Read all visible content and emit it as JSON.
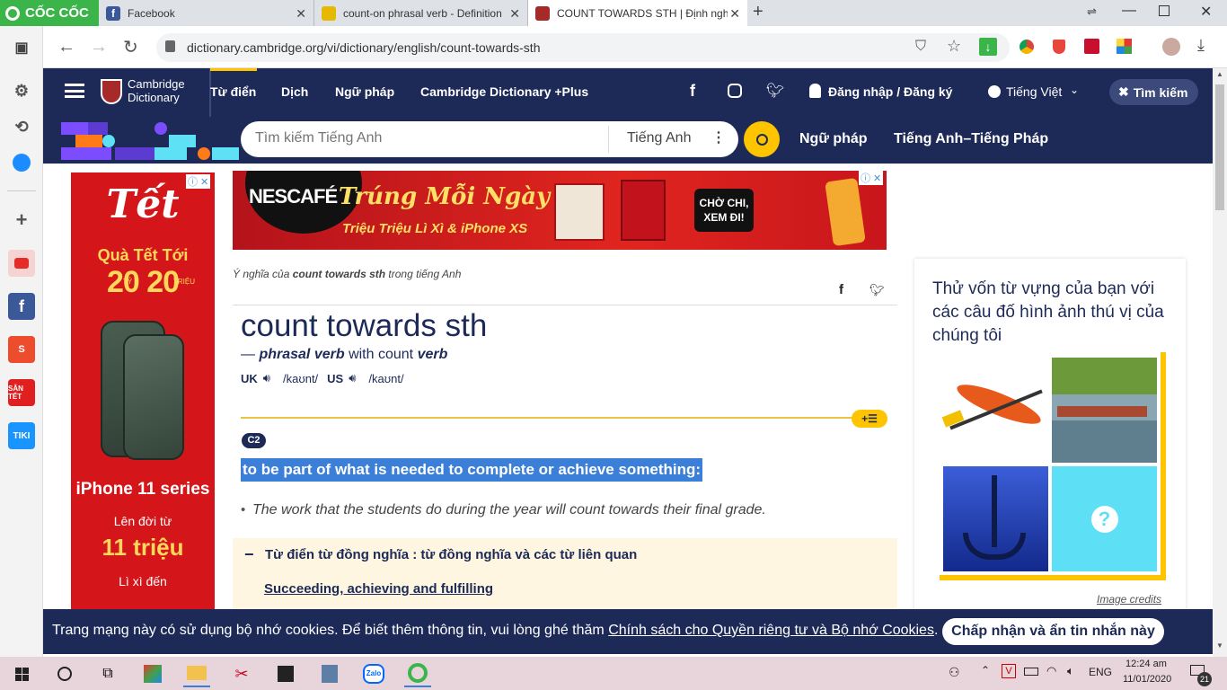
{
  "browser": {
    "logo": "CỐC CỐC",
    "tabs": [
      {
        "title": "Facebook",
        "favicon_color": "#3b5998"
      },
      {
        "title": "count-on phrasal verb - Definition",
        "favicon_color": "#e6b800"
      },
      {
        "title": "COUNT TOWARDS STH | Định nghĩ",
        "favicon_color": "#a72a2a"
      }
    ],
    "url": "dictionary.cambridge.org/vi/dictionary/english/count-towards-sth"
  },
  "site": {
    "logo_line1": "Cambridge",
    "logo_line2": "Dictionary",
    "nav": [
      "Từ điển",
      "Dịch",
      "Ngữ pháp",
      "Cambridge Dictionary +Plus"
    ],
    "login": "Đăng nhập / Đăng ký",
    "language": "Tiếng Việt",
    "search_btn": "Tìm kiếm",
    "search_placeholder": "Tìm kiếm Tiếng Anh",
    "search_lang": "Tiếng Anh",
    "sub_nav": [
      "Ngữ pháp",
      "Tiếng Anh–Tiếng Pháp"
    ]
  },
  "ad_left": {
    "title": "Tết",
    "line1": "Quà Tết Tới",
    "big": "20 20",
    "small1": "TỶ",
    "small2": "TRIỆU",
    "product": "iPhone 11 series",
    "line2": "Lên đời từ",
    "price": "11 triệu",
    "line3": "Lì xì đến"
  },
  "ad_top": {
    "brand": "NESCAFÉ",
    "slogan": "Trúng Mỗi Ngày",
    "sub": "Triệu Triệu Lì Xì & iPhone XS",
    "cta": "CHỜ CHI, XEM ĐI!"
  },
  "entry": {
    "breadcrumb_prefix": "Ý nghĩa của",
    "breadcrumb_word": "count towards sth",
    "breadcrumb_suffix": "trong tiếng Anh",
    "headword": "count towards sth",
    "pos_dash": "—",
    "pos": "phrasal verb",
    "pos_with": "with count",
    "pos_verb": "verb",
    "uk_label": "UK",
    "uk_ipa": "/kaʊnt/",
    "us_label": "US",
    "us_ipa": "/kaʊnt/",
    "level": "C2",
    "definition": "to be part of what is needed to complete or achieve something:",
    "example": "The work that the students do during the year will count towards their final grade.",
    "thesaurus_title": "Từ điển từ đồng nghĩa : từ đồng nghĩa và các từ liên quan",
    "thesaurus_link": "Succeeding, achieving and fulfilling"
  },
  "quiz": {
    "title": "Thử vốn từ vựng của bạn với các câu đố hình ảnh thú vị của chúng tôi",
    "credits": "Image credits"
  },
  "cookie": {
    "text": "Trang mạng này có sử dụng bộ nhớ cookies. Để biết thêm thông tin, vui lòng ghé thăm",
    "link": "Chính sách cho Quyền riêng tư và Bộ nhớ Cookies",
    "period": ".",
    "button": "Chấp nhận và ẩn tin nhắn này"
  },
  "taskbar": {
    "lang": "ENG",
    "time": "12:24 am",
    "date": "11/01/2020",
    "notif": "21"
  },
  "colors": {
    "navy": "#1d2a57",
    "yellow": "#fec400",
    "highlight": "#3b7fd9"
  }
}
